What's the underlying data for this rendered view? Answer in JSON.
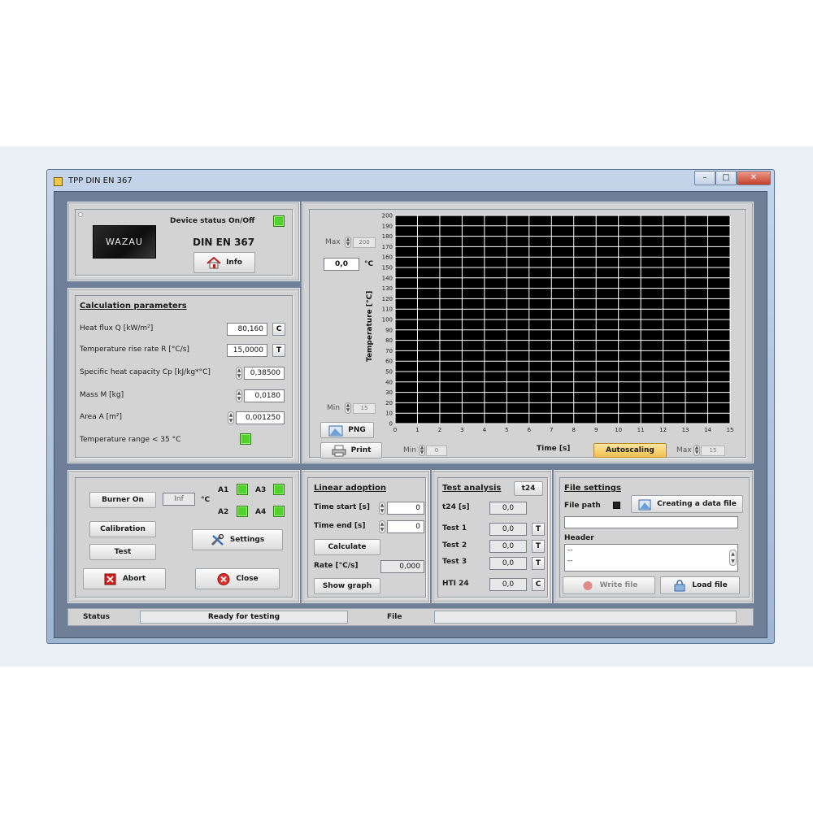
{
  "window": {
    "title": "TPP DIN EN 367",
    "min": "–",
    "max": "□",
    "close": "✕"
  },
  "device": {
    "status_label": "Device status On/Off",
    "standard": "DIN EN 367",
    "logo_text": "WAZAU",
    "info_button": "Info"
  },
  "calc": {
    "title": "Calculation parameters",
    "heat_flux_label": "Heat flux Q [kW/m²]",
    "heat_flux_value": "80,160",
    "heat_flux_btn": "C",
    "rise_rate_label": "Temperature rise rate R [°C/s]",
    "rise_rate_value": "15,0000",
    "rise_rate_btn": "T",
    "cp_label": "Specific heat capacity Cp [kJ/kg*°C]",
    "cp_value": "0,38500",
    "mass_label": "Mass M [kg]",
    "mass_value": "0,0180",
    "area_label": "Area A [m²]",
    "area_value": "0,001250",
    "temp_range_label": "Temperature range < 35 °C"
  },
  "chart_panel": {
    "max_label": "Max",
    "max_value": "200",
    "current_value": "0,0",
    "current_unit": "°C",
    "min_label": "Min",
    "min_value": "15",
    "png_button": "PNG",
    "print_button": "Print",
    "xmin_label": "Min",
    "xmin_value": "0",
    "xmax_label": "Max",
    "xmax_value": "15",
    "autoscaling_button": "Autoscaling"
  },
  "chart_data": {
    "type": "line",
    "title": "",
    "xlabel": "Time [s]",
    "ylabel": "Temperature [°C]",
    "xlim": [
      0,
      15
    ],
    "ylim": [
      0,
      200
    ],
    "x_ticks": [
      0,
      1,
      2,
      3,
      4,
      5,
      6,
      7,
      8,
      9,
      10,
      11,
      12,
      13,
      14,
      15
    ],
    "y_ticks": [
      0,
      10,
      20,
      30,
      40,
      50,
      60,
      70,
      80,
      90,
      100,
      110,
      120,
      130,
      140,
      150,
      160,
      170,
      180,
      190,
      200
    ],
    "grid": true,
    "series": []
  },
  "control": {
    "burner_button": "Burner On",
    "burner_value": "Inf",
    "burner_unit": "°C",
    "a1": "A1",
    "a2": "A2",
    "a3": "A3",
    "a4": "A4",
    "calibration_button": "Calibration",
    "test_button": "Test",
    "settings_button": "Settings",
    "abort_button": "Abort",
    "close_button": "Close"
  },
  "linear": {
    "title": "Linear adoption",
    "time_start_label": "Time start [s]",
    "time_start_value": "0",
    "time_end_label": "Time end [s]",
    "time_end_value": "0",
    "calculate_button": "Calculate",
    "rate_label": "Rate [°C/s]",
    "rate_value": "0,000",
    "show_graph_button": "Show graph"
  },
  "analysis": {
    "title": "Test analysis",
    "t24_button": "t24",
    "t24_label": "t24 [s]",
    "t24_value": "0,0",
    "test1_label": "Test 1",
    "test1_value": "0,0",
    "test2_label": "Test 2",
    "test2_value": "0,0",
    "test3_label": "Test 3",
    "test3_value": "0,0",
    "hti_label": "HTI 24",
    "hti_value": "0,0",
    "t_btn": "T",
    "c_btn": "C"
  },
  "file": {
    "title": "File settings",
    "path_label": "File path",
    "create_button": "Creating a data file",
    "header_label": "Header",
    "header_line1": "--",
    "header_line2": "--",
    "write_button": "Write file",
    "load_button": "Load file"
  },
  "statusbar": {
    "status_label": "Status",
    "status_value": "Ready for testing",
    "file_label": "File",
    "file_value": ""
  },
  "colors": {
    "led_green": "#52d22d",
    "plot_bg": "#000000",
    "grid": "#ffffff",
    "autoscale": "#f0c050",
    "abort_red": "#d42020",
    "close_red": "#e03030"
  }
}
